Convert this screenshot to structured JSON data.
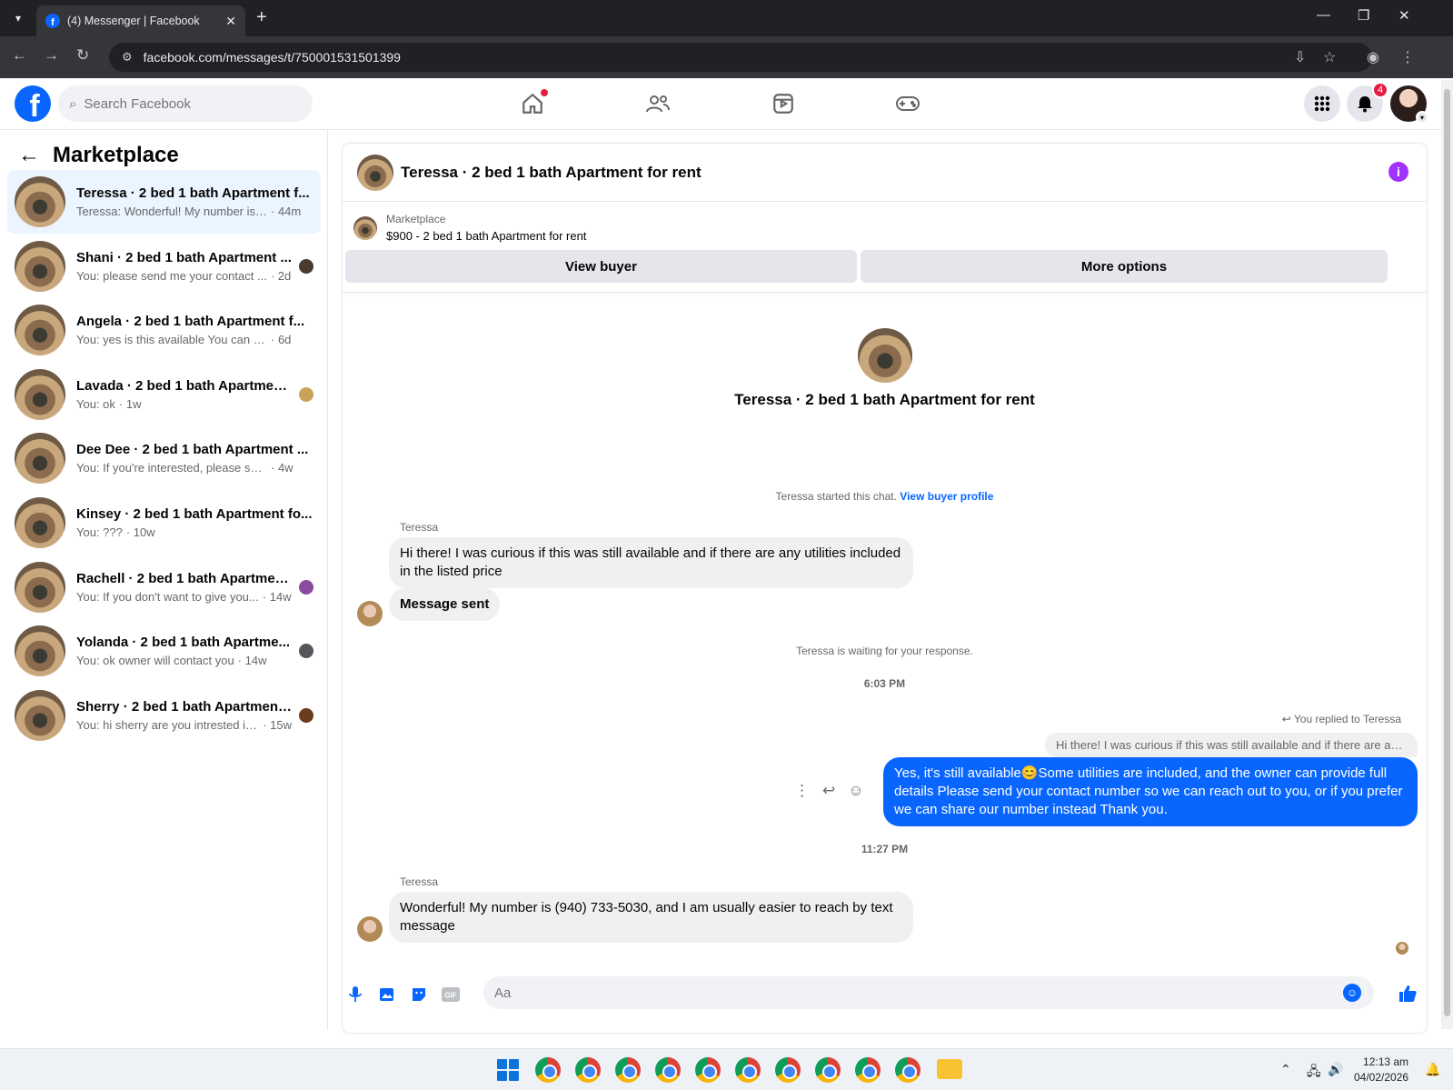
{
  "browser": {
    "tab_title": "(4) Messenger | Facebook",
    "url": "facebook.com/messages/t/750001531501399"
  },
  "fb": {
    "search_placeholder": "Search Facebook",
    "notif_count": "4"
  },
  "left": {
    "title": "Marketplace",
    "conversations": [
      {
        "name": "Teressa · 2 bed 1 bath Apartment f...",
        "snippet": "Teressa: Wonderful! My number is (...",
        "time": "· 44m"
      },
      {
        "name": "Shani · 2 bed 1 bath Apartment ...",
        "snippet": "You: please send me your contact ...",
        "time": "· 2d"
      },
      {
        "name": "Angela · 2 bed 1 bath Apartment f...",
        "snippet": "You: yes is this available You can cont...",
        "time": "· 6d"
      },
      {
        "name": "Lavada · 2 bed 1 bath Apartmen...",
        "snippet": "You: ok",
        "time": "· 1w"
      },
      {
        "name": "Dee Dee · 2 bed 1 bath Apartment ...",
        "snippet": "You: If you're interested, please share ...",
        "time": "· 4w"
      },
      {
        "name": "Kinsey · 2 bed 1 bath Apartment fo...",
        "snippet": "You: ???",
        "time": "· 10w"
      },
      {
        "name": "Rachell · 2 bed 1 bath Apartmen...",
        "snippet": "You: If you don't want to give you...",
        "time": "· 14w"
      },
      {
        "name": "Yolanda · 2 bed 1 bath Apartme...",
        "snippet": "You: ok owner will contact you",
        "time": "· 14w"
      },
      {
        "name": "Sherry · 2 bed 1 bath Apartment...",
        "snippet": "You: hi sherry are you intrested in...",
        "time": "· 15w"
      }
    ]
  },
  "chat": {
    "header_title": "Teressa · 2 bed 1 bath Apartment for rent",
    "marketplace_label": "Marketplace",
    "listing": "$900 - 2 bed 1 bath Apartment for rent",
    "view_buyer": "View buyer",
    "more_options": "More options",
    "intro_title": "Teressa · 2 bed 1 bath Apartment for rent",
    "started_note": "Teressa started this chat.",
    "view_buyer_profile": "View buyer profile",
    "sender_name": "Teressa",
    "msg1": "Hi there! I was curious if this was still available and if there are any utilities included in the listed price",
    "msg2": "Message sent",
    "waiting_note": "Teressa is waiting for your response.",
    "time1": "6:03 PM",
    "reply_label": "You replied to Teressa",
    "reply_quote": "Hi there! I was curious if this was still available and if there are any...",
    "my_reply": "Yes, it's still available😊Some utilities are included, and the owner can provide full details Please send your contact number so we can reach out to you, or if you prefer we can share our number instead Thank you.",
    "time2": "11:27 PM",
    "msg3": "Wonderful! My number is (940) 733-5030, and I am usually easier to reach by text message",
    "composer_placeholder": "Aa"
  },
  "taskbar": {
    "time": "12:13 am",
    "date": "04/02/2026"
  }
}
